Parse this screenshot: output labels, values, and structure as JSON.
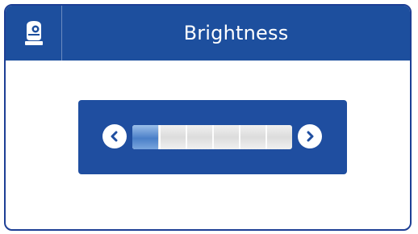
{
  "window": {
    "title": "Brightness"
  },
  "brightness": {
    "level": 0.16,
    "segments": 6
  },
  "icons": {
    "header": "camera-icon",
    "decrease": "chevron-left-icon",
    "increase": "chevron-right-icon"
  },
  "colors": {
    "header_bg": "#1d4f9e",
    "panel_bg": "#1f4ea0",
    "fill": "#4a7fc8",
    "border": "#1d3f95"
  }
}
